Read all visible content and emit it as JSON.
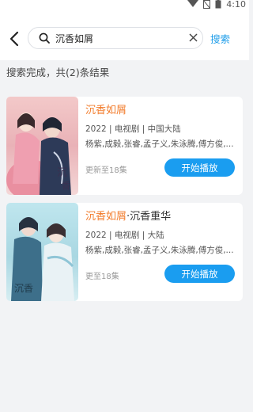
{
  "status_bar": {
    "time": "4:10"
  },
  "header": {
    "search": {
      "value": "沉香如屑",
      "placeholder": ""
    },
    "search_button_label": "搜索"
  },
  "summary": "搜索完成，共(2)条结果",
  "results": [
    {
      "title_main": "沉香如屑",
      "title_suffix": "",
      "meta": "2022 | 电视剧 | 中国大陆",
      "cast": "杨紫,成毅,张睿,孟子义,朱泳腾,傅方俊,...",
      "episodes": "更新至18集",
      "play_label": "开始播放",
      "poster_text": "沉香如屑"
    },
    {
      "title_main": "沉香如屑",
      "title_suffix": "·沉香重华",
      "meta": "2022 | 电视剧 | 大陆",
      "cast": "杨紫,成毅,张睿,孟子义,朱泳腾,傅方俊,...",
      "episodes": "更至18集",
      "play_label": "开始播放",
      "poster_text": "沉香如屑"
    }
  ],
  "colors": {
    "accent": "#1a9df0",
    "title": "#f27c2c",
    "background": "#f2f3f5"
  },
  "icons": [
    "back-arrow-icon",
    "search-icon",
    "clear-icon",
    "signal-icon",
    "battery-icon"
  ]
}
